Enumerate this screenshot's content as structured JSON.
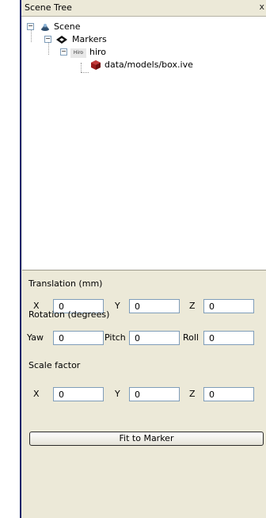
{
  "panel": {
    "title": "Scene Tree",
    "close_symbol": "x"
  },
  "tree": {
    "nodes": [
      {
        "label": "Scene",
        "icon": "scene-icon"
      },
      {
        "label": "Markers",
        "icon": "markers-icon"
      },
      {
        "label": "hiro",
        "icon": "hiro-marker-icon",
        "icon_text": "Hiro"
      },
      {
        "label": "data/models/box.ive",
        "icon": "model-cube-icon"
      }
    ],
    "expander_symbol": "−"
  },
  "translation": {
    "label": "Translation (mm)",
    "x_label": "X",
    "x_value": "0",
    "y_label": "Y",
    "y_value": "0",
    "z_label": "Z",
    "z_value": "0"
  },
  "rotation": {
    "label": "Rotation (degrees)",
    "yaw_label": "Yaw",
    "yaw_value": "0",
    "pitch_label": "Pitch",
    "pitch_value": "0",
    "roll_label": "Roll",
    "roll_value": "0"
  },
  "scale": {
    "label": "Scale factor",
    "x_label": "X",
    "x_value": "0",
    "y_label": "Y",
    "y_value": "0",
    "z_label": "Z",
    "z_value": "0"
  },
  "actions": {
    "fit_label": "Fit to Marker"
  },
  "colors": {
    "dock_bg": "#ece9d8",
    "accent_border": "#0a246a",
    "cube": "#9b1b1b"
  }
}
